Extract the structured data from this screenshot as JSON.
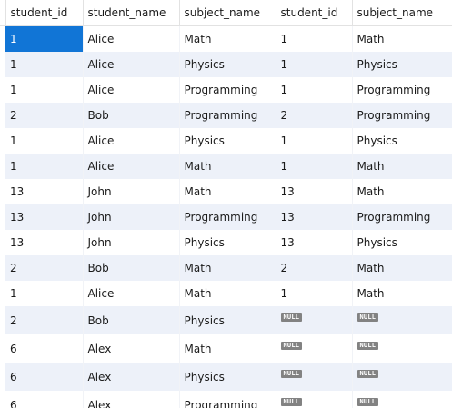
{
  "columns": [
    "student_id",
    "student_name",
    "subject_name",
    "student_id",
    "subject_name"
  ],
  "null_label": "NULL",
  "colors": {
    "selected_cell": "#1175d6",
    "alt_row": "#edf1f9",
    "null_badge": "#828282"
  },
  "rows": [
    [
      "1",
      "Alice",
      "Math",
      "1",
      "Math"
    ],
    [
      "1",
      "Alice",
      "Physics",
      "1",
      "Physics"
    ],
    [
      "1",
      "Alice",
      "Programming",
      "1",
      "Programming"
    ],
    [
      "2",
      "Bob",
      "Programming",
      "2",
      "Programming"
    ],
    [
      "1",
      "Alice",
      "Physics",
      "1",
      "Physics"
    ],
    [
      "1",
      "Alice",
      "Math",
      "1",
      "Math"
    ],
    [
      "13",
      "John",
      "Math",
      "13",
      "Math"
    ],
    [
      "13",
      "John",
      "Programming",
      "13",
      "Programming"
    ],
    [
      "13",
      "John",
      "Physics",
      "13",
      "Physics"
    ],
    [
      "2",
      "Bob",
      "Math",
      "2",
      "Math"
    ],
    [
      "1",
      "Alice",
      "Math",
      "1",
      "Math"
    ],
    [
      "2",
      "Bob",
      "Physics",
      null,
      null
    ],
    [
      "6",
      "Alex",
      "Math",
      null,
      null
    ],
    [
      "6",
      "Alex",
      "Physics",
      null,
      null
    ],
    [
      "6",
      "Alex",
      "Programming",
      null,
      null
    ]
  ]
}
